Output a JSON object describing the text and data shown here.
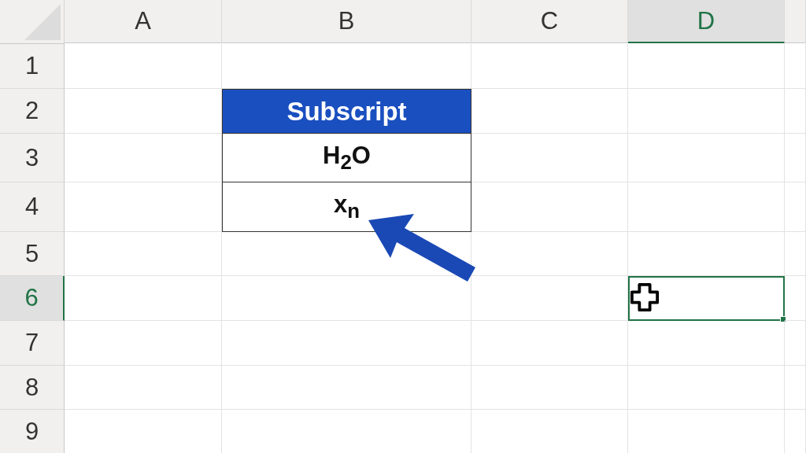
{
  "columns": [
    {
      "label": "A",
      "selected": false
    },
    {
      "label": "B",
      "selected": false
    },
    {
      "label": "C",
      "selected": false
    },
    {
      "label": "D",
      "selected": true
    }
  ],
  "rows": [
    {
      "label": "1",
      "selected": false
    },
    {
      "label": "2",
      "selected": false
    },
    {
      "label": "3",
      "selected": false
    },
    {
      "label": "4",
      "selected": false
    },
    {
      "label": "5",
      "selected": false
    },
    {
      "label": "6",
      "selected": true
    },
    {
      "label": "7",
      "selected": false
    },
    {
      "label": "8",
      "selected": false
    },
    {
      "label": "9",
      "selected": false
    }
  ],
  "table": {
    "header": "Subscript",
    "cells": [
      "H$_{2}$O",
      "x$_{n}$"
    ]
  }
}
